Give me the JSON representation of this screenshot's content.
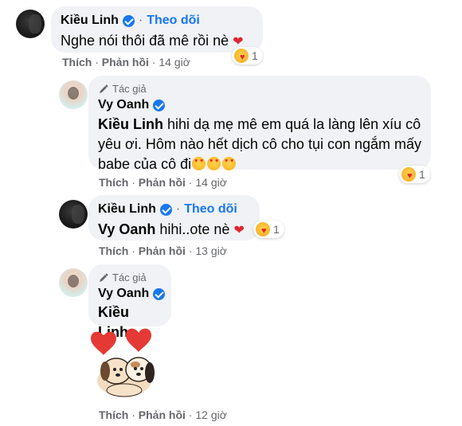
{
  "comments": [
    {
      "author": "Kiều Linh",
      "follow_label": "Theo dõi",
      "text": "Nghe nói thôi đã mê rồi nè",
      "heart": "❤",
      "meta": {
        "like": "Thích",
        "reply": "Phản hồi",
        "time": "14 giờ"
      },
      "reaction_count": "1"
    },
    {
      "badge": "Tác giả",
      "author": "Vy Oanh",
      "mention": "Kiều Linh",
      "text": "hihi dạ mẹ mê em quá la làng lên xíu cô yêu ơi. Hôm nào hết dịch cô cho tụi con ngắm mấy babe của cô đi",
      "meta": {
        "like": "Thích",
        "reply": "Phản hồi",
        "time": "14 giờ"
      },
      "reaction_count": "1"
    },
    {
      "author": "Kiều Linh",
      "follow_label": "Theo dõi",
      "mention": "Vy Oanh",
      "text": "hihi..ote nè",
      "heart": "❤",
      "meta": {
        "like": "Thích",
        "reply": "Phản hồi",
        "time": "13 giờ"
      },
      "reaction_count": "1"
    },
    {
      "badge": "Tác giả",
      "author": "Vy Oanh",
      "mention": "Kiều Linh",
      "meta": {
        "like": "Thích",
        "reply": "Phản hồi",
        "time": "12 giờ"
      }
    }
  ],
  "colors": {
    "accent": "#1877f2",
    "bubble": "#f0f2f5",
    "meta": "#65676b",
    "heart": "#e0262f"
  },
  "icons": [
    "verified-badge-icon",
    "author-pen-icon",
    "care-reaction-icon",
    "heart-icon",
    "heart-eyes-emoji-icon",
    "dogs-sticker"
  ]
}
